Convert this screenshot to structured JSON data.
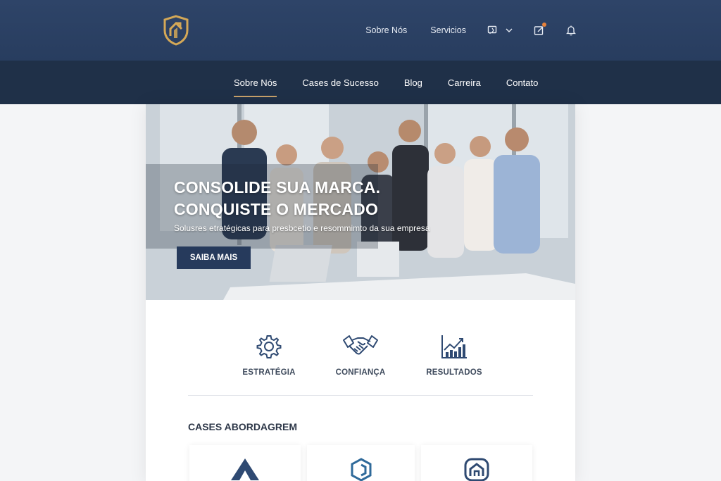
{
  "topbar": {
    "links": [
      "Sobre Nós",
      "Servicios"
    ],
    "icons": [
      "language-icon",
      "chevron-down-icon",
      "edit-icon",
      "bell-icon"
    ]
  },
  "mainnav": {
    "items": [
      "Sobre Nós",
      "Cases de Sucesso",
      "Blog",
      "Carreira",
      "Contato"
    ],
    "active": "Sobre Nós"
  },
  "hero": {
    "title_line1": "CONSOLIDE SUA MARCA.",
    "title_line2": "CONQUISTE O MERCADO",
    "subtitle": "Solusres etratégicas para presbcetio e resommimto da sua empresa",
    "button": "SAIBA MAIS"
  },
  "features": [
    {
      "label": "ESTRATÉGIA",
      "icon": "gear-icon"
    },
    {
      "label": "CONFIANÇA",
      "icon": "handshake-icon"
    },
    {
      "label": "RESULTADOS",
      "icon": "chart-icon"
    }
  ],
  "cases": {
    "title": "CASES ABORDAGREM",
    "logos": [
      "triangle-logo-icon",
      "hexagon-logo-icon",
      "house-logo-icon"
    ]
  },
  "colors": {
    "topbar": "#2e4468",
    "nav": "#1f3048",
    "accent_gold": "#c8a16a",
    "button": "#263a5c",
    "notification_dot": "#e8823a"
  }
}
